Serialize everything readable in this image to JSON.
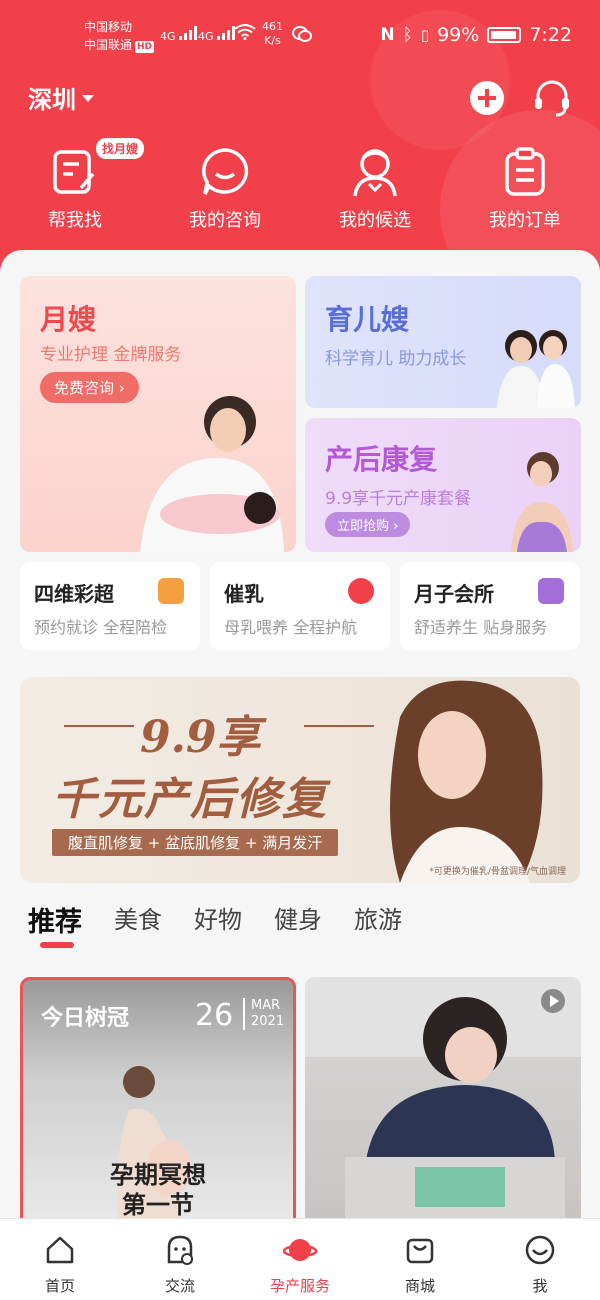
{
  "status_bar": {
    "carrier1": "中国移动",
    "carrier2": "中国联通",
    "hd": "HD",
    "net1": "4G",
    "net2": "4G",
    "speed_value": "461",
    "speed_unit": "K/s",
    "battery": "99%",
    "time": "7:22"
  },
  "topbar": {
    "city": "深圳"
  },
  "quick_actions": [
    {
      "label": "帮我找",
      "tag": "找月嫂",
      "icon": "edit-form-icon"
    },
    {
      "label": "我的咨询",
      "icon": "chat-bubble-icon"
    },
    {
      "label": "我的候选",
      "icon": "nanny-person-icon"
    },
    {
      "label": "我的订单",
      "icon": "order-clipboard-icon"
    }
  ],
  "cards": {
    "yuesao": {
      "title": "月嫂",
      "subtitle": "专业护理 金牌服务",
      "button": "免费咨询 ›"
    },
    "yuer": {
      "title": "育儿嫂",
      "subtitle": "科学育儿 助力成长"
    },
    "chanhou": {
      "title": "产后康复",
      "subtitle": "9.9享千元产康套餐",
      "button": "立即抢购 ›"
    }
  },
  "mini_cards": [
    {
      "title": "四维彩超",
      "subtitle": "预约就诊 全程陪检",
      "badge_color": "#f5a040"
    },
    {
      "title": "催乳",
      "subtitle": "母乳喂养 全程护航",
      "badge_color": "#f2404a"
    },
    {
      "title": "月子会所",
      "subtitle": "舒适养生 贴身服务",
      "badge_color": "#a56cdc"
    }
  ],
  "banner": {
    "line1": "9.9享",
    "line2": "千元产后修复",
    "line3": "腹直肌修复 + 盆底肌修复 + 满月发汗",
    "note": "*可更换为催乳/骨盆调理/气血调理"
  },
  "tabs": [
    "推荐",
    "美食",
    "好物",
    "健身",
    "旅游"
  ],
  "feed": {
    "card1": {
      "title": "今日树冠",
      "day": "26",
      "month": "MAR",
      "year": "2021",
      "caption_line1": "孕期冥想",
      "caption_line2": "第一节"
    }
  },
  "bottom_nav": [
    {
      "label": "首页",
      "icon": "home-icon"
    },
    {
      "label": "交流",
      "icon": "community-icon"
    },
    {
      "label": "孕产服务",
      "icon": "planet-icon"
    },
    {
      "label": "商城",
      "icon": "shopping-bag-icon"
    },
    {
      "label": "我",
      "icon": "smiley-face-icon"
    }
  ],
  "colors": {
    "brand": "#f2404a"
  }
}
